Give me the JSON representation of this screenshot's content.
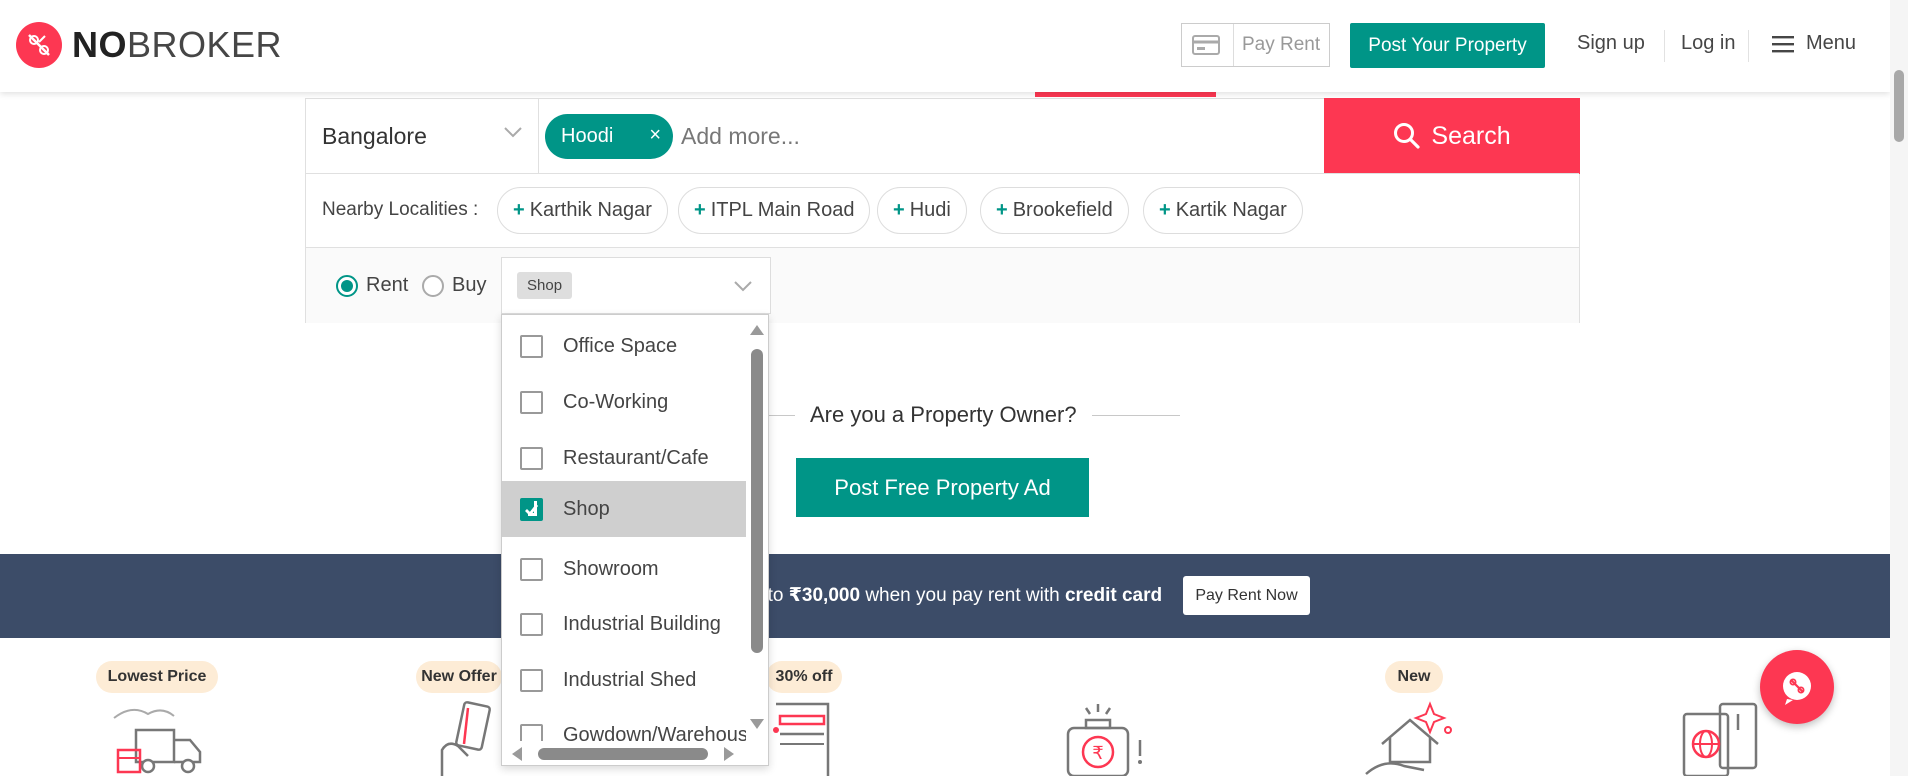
{
  "header": {
    "logo_bold": "NO",
    "logo_light": "BROKER",
    "pay_rent": "Pay Rent",
    "post_property": "Post Your Property",
    "sign_up": "Sign up",
    "log_in": "Log in",
    "menu": "Menu"
  },
  "search": {
    "city": "Bangalore",
    "selected_locality": "Hoodi",
    "remove_chip": "×",
    "placeholder": "Add more...",
    "button": "Search",
    "nearby_label": "Nearby Localities :",
    "nearby": [
      "Karthik Nagar",
      "ITPL Main Road",
      "Hudi",
      "Brookefield",
      "Kartik Nagar"
    ],
    "plus": "+",
    "mode": {
      "rent": "Rent",
      "buy": "Buy",
      "selected": "rent"
    },
    "property_type_tag": "Shop"
  },
  "dropdown": {
    "items": [
      {
        "label": "Office Space",
        "checked": false
      },
      {
        "label": "Co-Working",
        "checked": false
      },
      {
        "label": "Restaurant/Cafe",
        "checked": false
      },
      {
        "label": "Shop",
        "checked": true
      },
      {
        "label": "Showroom",
        "checked": false
      },
      {
        "label": "Industrial Building",
        "checked": false
      },
      {
        "label": "Industrial Shed",
        "checked": false
      },
      {
        "label": "Gowdown/Warehouse",
        "checked": false
      }
    ]
  },
  "owner": {
    "title": "Are you a Property Owner?",
    "button": "Post Free Property Ad"
  },
  "banner": {
    "text_pre": "pto ",
    "amount": "₹30,000",
    "text_mid": " when you pay rent with ",
    "text_bold": "credit card",
    "button": "Pay Rent Now"
  },
  "services": {
    "badges": [
      "Lowest Price",
      "New Offer",
      "30% off",
      "New"
    ]
  },
  "colors": {
    "brand_red": "#fd3752",
    "brand_teal": "#009587",
    "banner_navy": "#3c4c68",
    "badge_bg": "#fdecd6"
  }
}
